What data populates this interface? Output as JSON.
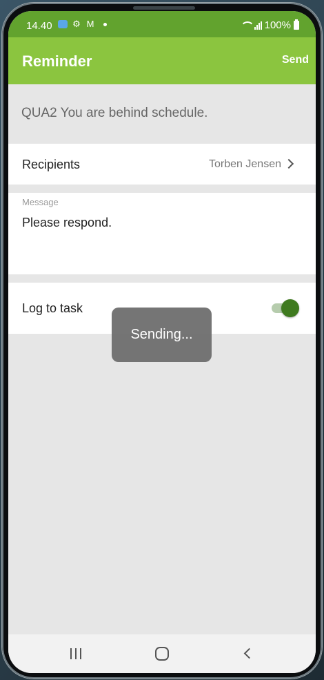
{
  "status_bar": {
    "time": "14.40",
    "battery": "100%",
    "left_icons": [
      "app-icon",
      "gear-icon",
      "mail-icon",
      "dot-icon"
    ],
    "right_icons": [
      "wifi-icon",
      "signal-icon",
      "battery-icon"
    ]
  },
  "app_bar": {
    "title": "Reminder",
    "send_label": "Send",
    "background": "#8bc53f"
  },
  "subject": "QUA2 You are behind schedule.",
  "recipients": {
    "label": "Recipients",
    "value": "Torben Jensen"
  },
  "message": {
    "caption": "Message",
    "text": "Please respond."
  },
  "log_to_task": {
    "label": "Log to task",
    "enabled": true
  },
  "toast": {
    "text": "Sending..."
  },
  "nav_bar": {
    "buttons": [
      "recents",
      "home",
      "back"
    ]
  },
  "colors": {
    "status_bar": "#62a32e",
    "accent": "#3f7a1f",
    "background": "#e6e6e6"
  }
}
